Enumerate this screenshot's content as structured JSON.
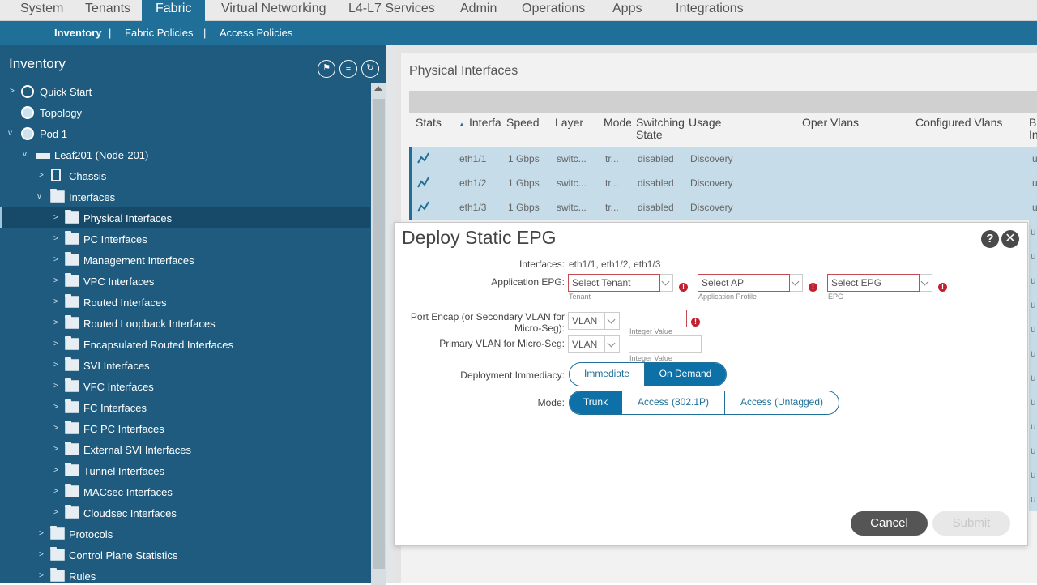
{
  "topnav": {
    "tabs": [
      "System",
      "Tenants",
      "Fabric",
      "Virtual Networking",
      "L4-L7 Services",
      "Admin",
      "Operations",
      "Apps",
      "Integrations"
    ],
    "active": "Fabric"
  },
  "subnav": {
    "items": [
      "Inventory",
      "Fabric Policies",
      "Access Policies"
    ],
    "separator": "|"
  },
  "left": {
    "title": "Inventory",
    "tree": [
      {
        "label": "Quick Start",
        "icon": "quick-start-icon"
      },
      {
        "label": "Topology",
        "icon": "topology-icon"
      },
      {
        "label": "Pod 1",
        "icon": "pod-icon"
      },
      {
        "label": "Leaf201 (Node-201)",
        "icon": "leaf-switch-icon"
      },
      {
        "label": "Chassis",
        "icon": "chassis-icon"
      },
      {
        "label": "Interfaces",
        "icon": "folder-icon"
      },
      {
        "label": "Physical Interfaces",
        "icon": "folder-icon"
      },
      {
        "label": "PC Interfaces",
        "icon": "folder-icon"
      },
      {
        "label": "Management Interfaces",
        "icon": "folder-icon"
      },
      {
        "label": "VPC Interfaces",
        "icon": "folder-icon"
      },
      {
        "label": "Routed Interfaces",
        "icon": "folder-icon"
      },
      {
        "label": "Routed Loopback Interfaces",
        "icon": "folder-icon"
      },
      {
        "label": "Encapsulated Routed Interfaces",
        "icon": "folder-icon"
      },
      {
        "label": "SVI Interfaces",
        "icon": "folder-icon"
      },
      {
        "label": "VFC Interfaces",
        "icon": "folder-icon"
      },
      {
        "label": "FC Interfaces",
        "icon": "folder-icon"
      },
      {
        "label": "FC PC Interfaces",
        "icon": "folder-icon"
      },
      {
        "label": "External SVI Interfaces",
        "icon": "folder-icon"
      },
      {
        "label": "Tunnel Interfaces",
        "icon": "folder-icon"
      },
      {
        "label": "MACsec Interfaces",
        "icon": "folder-icon"
      },
      {
        "label": "Cloudsec Interfaces",
        "icon": "folder-icon"
      },
      {
        "label": "Protocols",
        "icon": "folder-icon"
      },
      {
        "label": "Control Plane Statistics",
        "icon": "folder-icon"
      },
      {
        "label": "Rules",
        "icon": "folder-icon"
      }
    ]
  },
  "right": {
    "title": "Physical Interfaces",
    "columns": [
      "Stats",
      "Interfa",
      "Speed",
      "Layer",
      "Mode",
      "Switching State",
      "Usage",
      "Oper Vlans",
      "Configured Vlans",
      "B In"
    ],
    "rows": [
      {
        "interface": "eth1/1",
        "speed": "1 Gbps",
        "layer": "switc...",
        "mode": "tr...",
        "state": "disabled",
        "usage": "Discovery"
      },
      {
        "interface": "eth1/2",
        "speed": "1 Gbps",
        "layer": "switc...",
        "mode": "tr...",
        "state": "disabled",
        "usage": "Discovery"
      },
      {
        "interface": "eth1/3",
        "speed": "1 Gbps",
        "layer": "switc...",
        "mode": "tr...",
        "state": "disabled",
        "usage": "Discovery"
      }
    ],
    "overflow_cell": "u"
  },
  "dialog": {
    "title": "Deploy Static EPG",
    "help": "?",
    "close": "✕",
    "interfaces_label": "Interfaces:",
    "interfaces_value": "eth1/1, eth1/2, eth1/3",
    "app_epg_label": "Application EPG:",
    "tenant_placeholder": "Select Tenant",
    "tenant_hint": "Tenant",
    "ap_placeholder": "Select AP",
    "ap_hint": "Application Profile",
    "epg_placeholder": "Select EPG",
    "epg_hint": "EPG",
    "port_encap_label": "Port Encap (or Secondary VLAN for Micro-Seg):",
    "port_encap_type": "VLAN",
    "port_encap_hint": "Integer Value",
    "primary_vlan_label": "Primary VLAN for Micro-Seg:",
    "primary_vlan_type": "VLAN",
    "primary_vlan_hint": "Integer Value",
    "immediacy_label": "Deployment Immediacy:",
    "immediacy_options": [
      "Immediate",
      "On Demand"
    ],
    "immediacy_selected": "On Demand",
    "mode_label": "Mode:",
    "mode_options": [
      "Trunk",
      "Access (802.1P)",
      "Access (Untagged)"
    ],
    "mode_selected": "Trunk",
    "cancel": "Cancel",
    "submit": "Submit"
  }
}
